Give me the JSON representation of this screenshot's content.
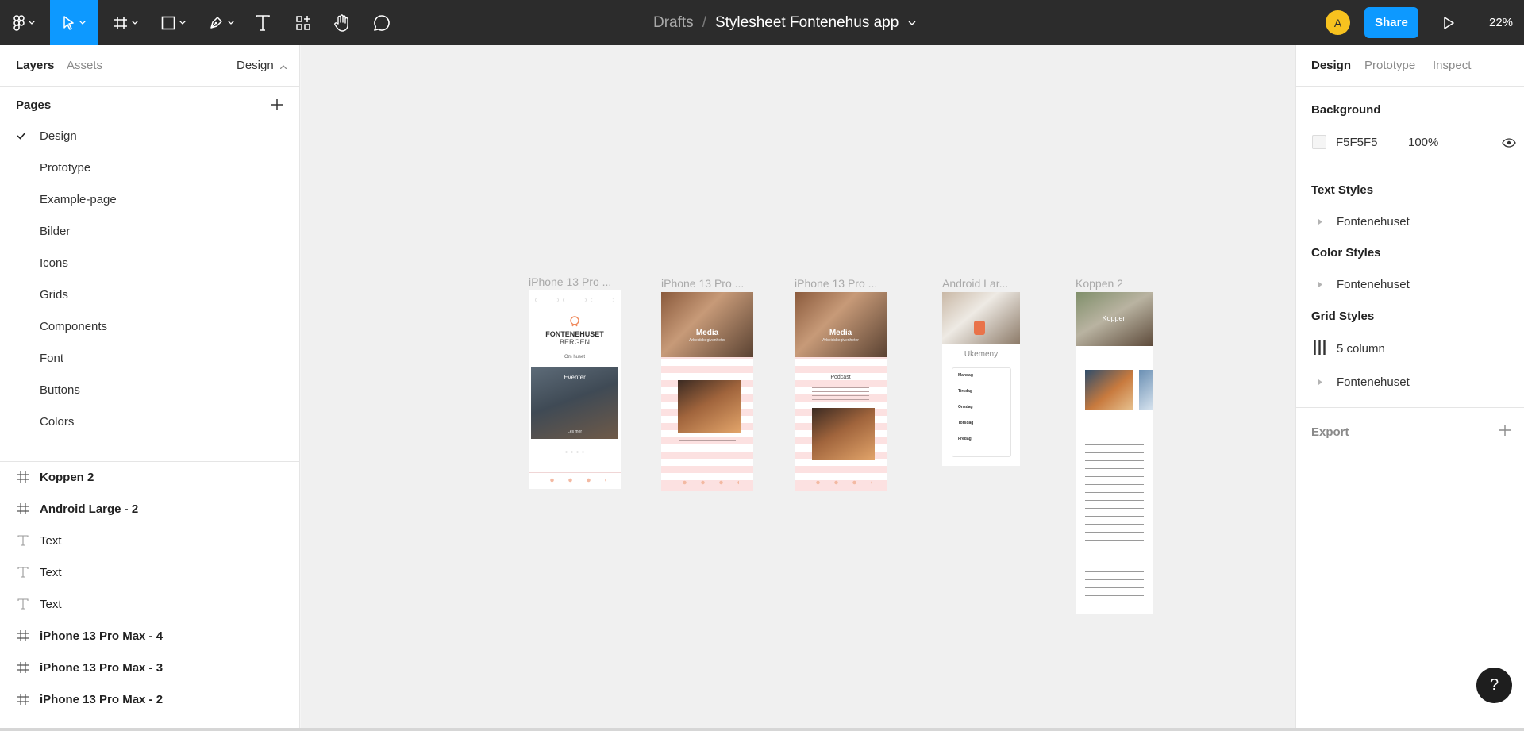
{
  "toolbar": {
    "breadcrumb_drafts": "Drafts",
    "breadcrumb_sep": "/",
    "file_name": "Stylesheet Fontenehus app",
    "avatar_initial": "A",
    "share_label": "Share",
    "zoom": "22%",
    "colors": {
      "bar": "#2c2c2c",
      "accent": "#0d99ff",
      "avatar": "#f7c21f"
    }
  },
  "left_panel": {
    "tabs": {
      "layers": "Layers",
      "assets": "Assets",
      "design_dropdown": "Design"
    },
    "pages_heading": "Pages",
    "pages": [
      "Design",
      "Prototype",
      "Example-page",
      "Bilder",
      "Icons",
      "Grids",
      "Components",
      "Font",
      "Buttons",
      "Colors"
    ],
    "current_page": "Design",
    "layers": [
      {
        "type": "frame",
        "name": "Koppen 2"
      },
      {
        "type": "frame",
        "name": "Android Large - 2"
      },
      {
        "type": "text",
        "name": "Text"
      },
      {
        "type": "text",
        "name": "Text"
      },
      {
        "type": "text",
        "name": "Text"
      },
      {
        "type": "frame",
        "name": "iPhone 13 Pro Max - 4"
      },
      {
        "type": "frame",
        "name": "iPhone 13 Pro Max - 3"
      },
      {
        "type": "frame",
        "name": "iPhone 13 Pro Max - 2"
      }
    ]
  },
  "canvas": {
    "frame_labels": [
      "iPhone 13 Pro ...",
      "iPhone 13 Pro ...",
      "iPhone 13 Pro ...",
      "Android Lar...",
      "Koppen 2"
    ],
    "frame1": {
      "logo_line1": "FONTENEHUSET",
      "logo_line2": "BERGEN",
      "link": "Om huset",
      "card": "Eventer",
      "card_sub": "Les mer"
    },
    "frame2": {
      "hero": "Media",
      "hero_sub": "Arbeidsbegivenheter"
    },
    "frame3": {
      "hero": "Media",
      "hero_sub": "Arbeidsbegivenheter",
      "section": "Podcast"
    },
    "frame4": {
      "title": "Ukemeny",
      "days": [
        "Mandag",
        "Tirsdag",
        "Onsdag",
        "Torsdag",
        "Fredag"
      ]
    },
    "frame5": {
      "hero": "Koppen"
    }
  },
  "right_panel": {
    "tabs": {
      "design": "Design",
      "prototype": "Prototype",
      "inspect": "Inspect"
    },
    "background_heading": "Background",
    "background_hex": "F5F5F5",
    "background_opacity": "100%",
    "text_styles_heading": "Text Styles",
    "text_style": "Fontenehuset",
    "color_styles_heading": "Color Styles",
    "color_style": "Fontenehuset",
    "grid_styles_heading": "Grid Styles",
    "grid_style_1": "5 column",
    "grid_style_2": "Fontenehuset",
    "export_heading": "Export"
  },
  "help_label": "?"
}
